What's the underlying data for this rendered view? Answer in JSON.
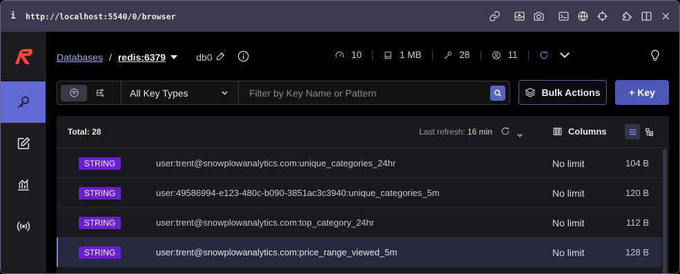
{
  "browser": {
    "url": "http://localhost:5540/0/browser",
    "info_glyph": "i",
    "toolbar_icons": [
      "link-icon",
      "inbox-icon",
      "camera-icon",
      "terminal-icon",
      "globe-icon",
      "crosshair-icon",
      "extension-icon",
      "split-view-icon",
      "close-icon"
    ]
  },
  "sidebar": {
    "logo": "redis-insight-logo",
    "items": [
      {
        "name": "browser",
        "icon": "key-icon",
        "active": true
      },
      {
        "name": "workbench",
        "icon": "edit-icon",
        "active": false
      },
      {
        "name": "analysis",
        "icon": "analytics-icon",
        "active": false
      },
      {
        "name": "pubsub",
        "icon": "broadcast-icon",
        "active": false
      }
    ]
  },
  "header": {
    "breadcrumb_root": "Databases",
    "separator": "/",
    "database": "redis:6379",
    "db_index": "db0",
    "stats": {
      "cpu": "10",
      "memory": "1 MB",
      "keys": "28",
      "clients": "11"
    }
  },
  "filter": {
    "key_type": "All Key Types",
    "search_placeholder": "Filter by Key Name or Pattern"
  },
  "actions": {
    "bulk_label": "Bulk Actions",
    "add_label": "+ Key"
  },
  "list": {
    "total_label": "Total: 28",
    "last_refresh_label": "Last refresh:",
    "last_refresh_value": "16 min",
    "columns_label": "Columns",
    "rows": [
      {
        "type": "STRING",
        "name": "user:trent@snowplowanalytics.com:unique_categories_24hr",
        "ttl": "No limit",
        "size": "104 B"
      },
      {
        "type": "STRING",
        "name": "user:49586994-e123-480c-b090-3851ac3c3940:unique_categories_5m",
        "ttl": "No limit",
        "size": "120 B"
      },
      {
        "type": "STRING",
        "name": "user:trent@snowplowanalytics.com:top_category_24hr",
        "ttl": "No limit",
        "size": "112 B"
      },
      {
        "type": "STRING",
        "name": "user:trent@snowplowanalytics.com:price_range_viewed_5m",
        "ttl": "No limit",
        "size": "128 B"
      }
    ]
  },
  "colors": {
    "accent": "#5f6ad7",
    "string_badge": "#6a1fd1",
    "link": "#9ea6ff",
    "topbar": "#3b3a4e"
  }
}
